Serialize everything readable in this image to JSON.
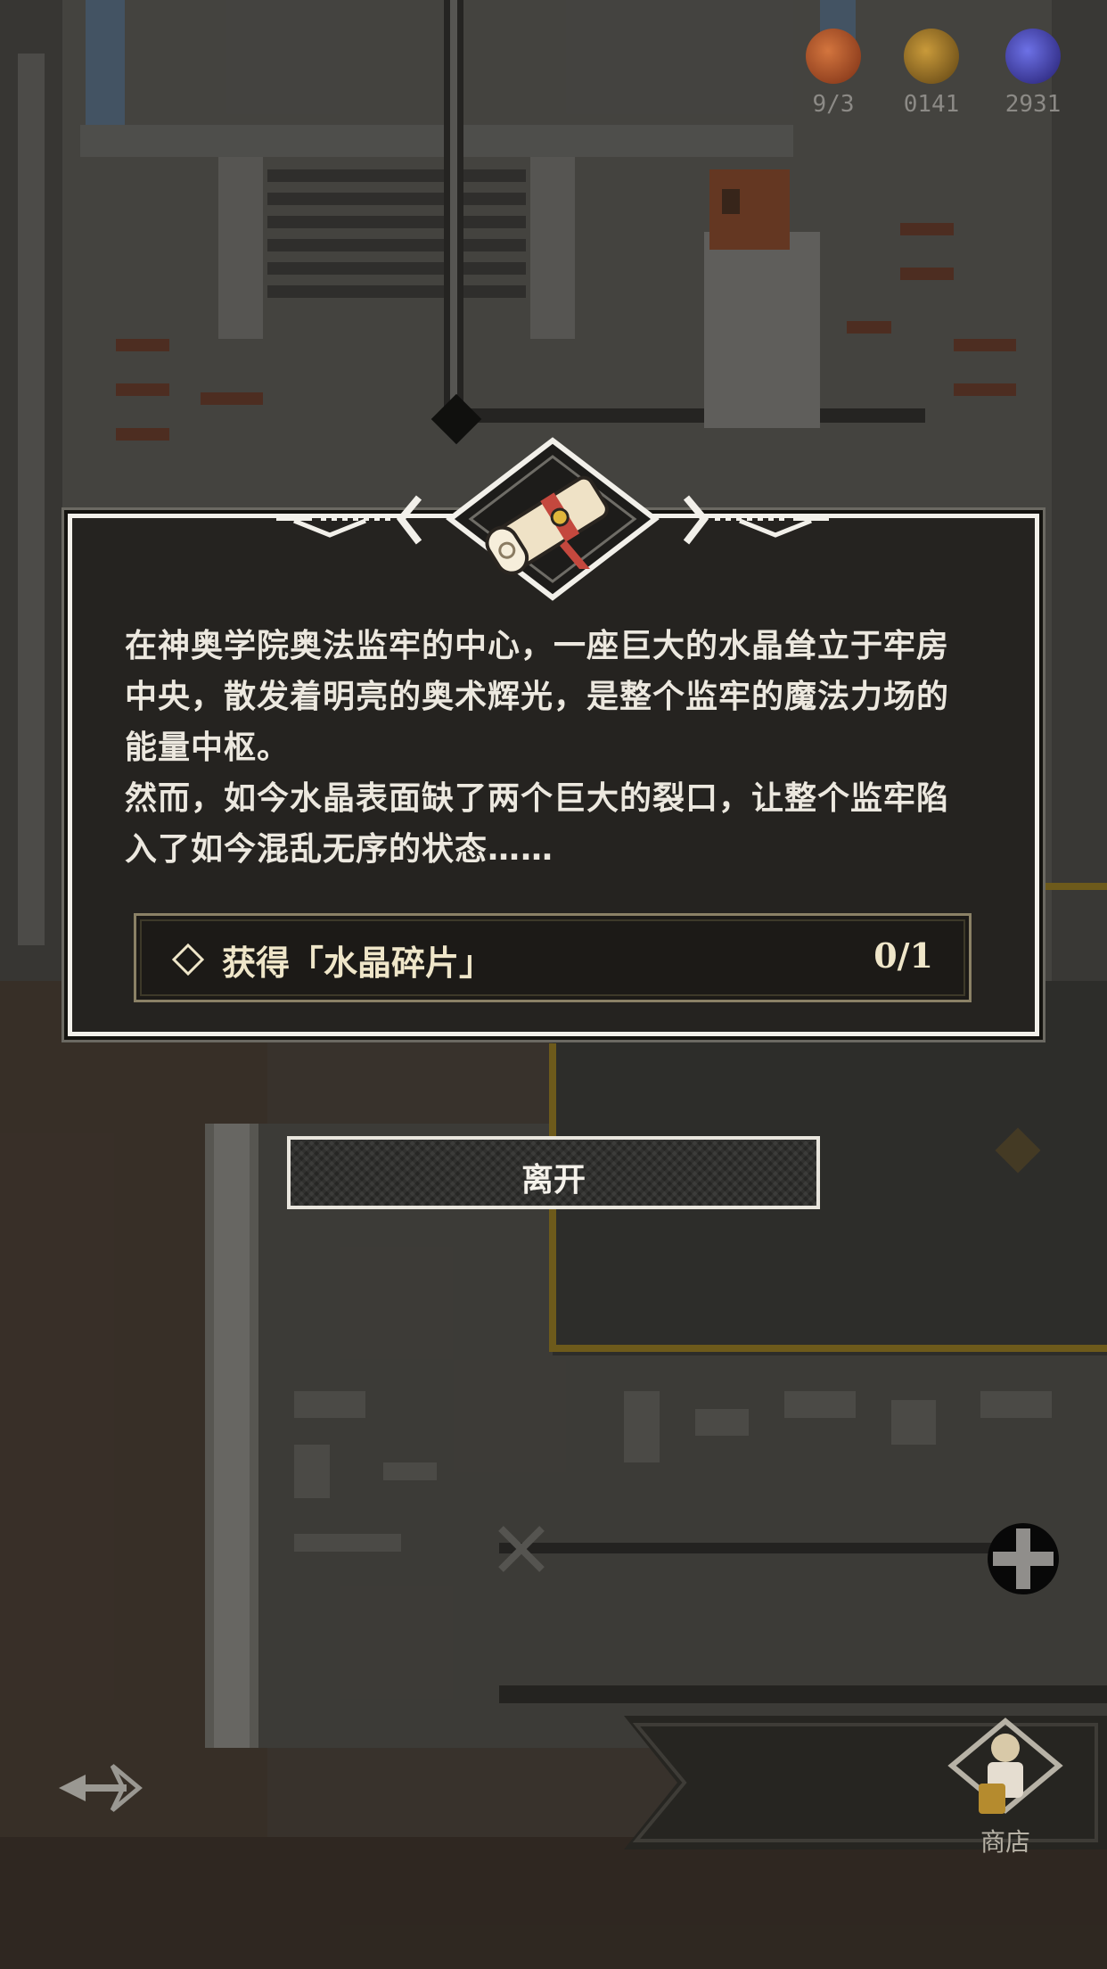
{
  "resources": [
    {
      "icon": "fire-orb-icon",
      "count": "9/3",
      "color": "#b5552a"
    },
    {
      "icon": "gold-coin-icon",
      "count": "0141",
      "color": "#a87b22"
    },
    {
      "icon": "crystal-icon",
      "count": "2931",
      "color": "#4b4fc8"
    }
  ],
  "dialog": {
    "paragraph1": "在神奥学院奥法监牢的中心，一座巨大的水晶耸立于牢房中央，散发着明亮的奥术辉光，是整个监牢的魔法力场的能量中枢。",
    "paragraph2": "然而，如今水晶表面缺了两个巨大的裂口，让整个监牢陷入了如今混乱无序的状态……",
    "objective_label": "获得「水晶碎片」",
    "objective_progress": "0/1"
  },
  "leave_button": "离开",
  "shop": {
    "label": "商店"
  },
  "colors": {
    "accent_gold": "#c8a23a",
    "panel_bg": "#252320",
    "text": "#ece8df"
  }
}
